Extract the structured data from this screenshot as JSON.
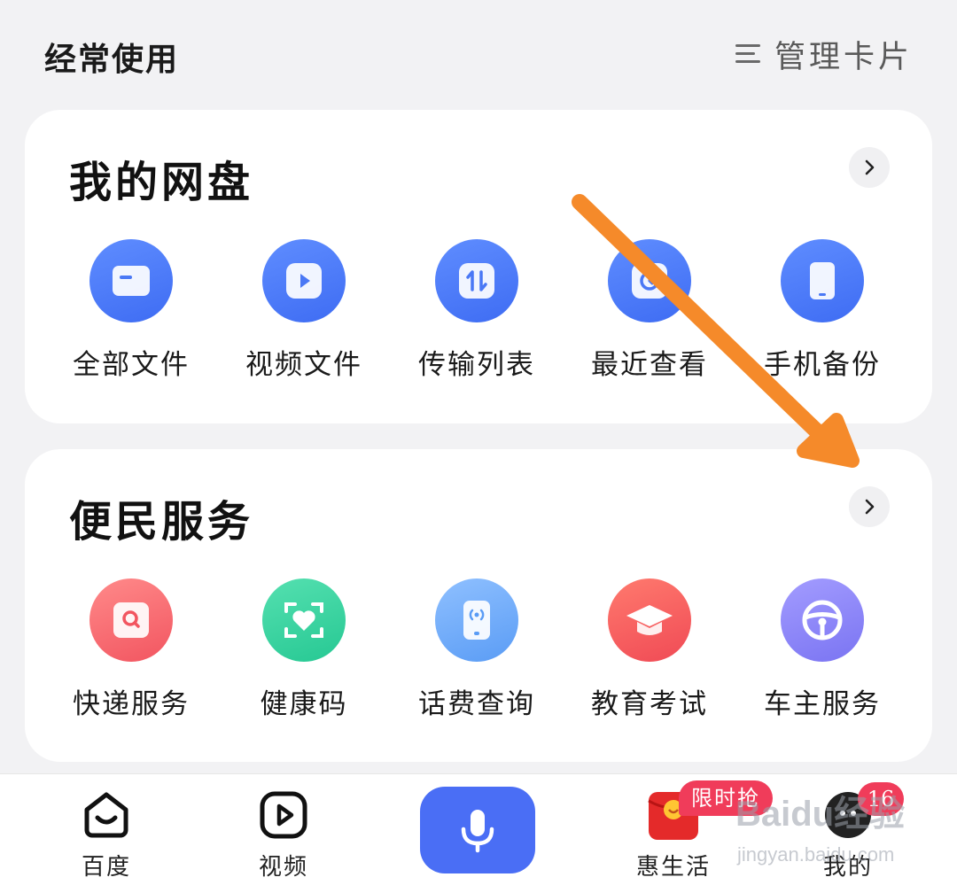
{
  "header": {
    "title": "经常使用",
    "manage_label": "管理卡片",
    "manage_icon": "menu-lines-icon"
  },
  "cards": [
    {
      "title": "我的网盘",
      "more_icon": "chevron-right-icon",
      "items": [
        {
          "label": "全部文件",
          "icon": "folder-icon",
          "color": "#4a78f5"
        },
        {
          "label": "视频文件",
          "icon": "play-icon",
          "color": "#4a78f5"
        },
        {
          "label": "传输列表",
          "icon": "transfer-icon",
          "color": "#4a78f5"
        },
        {
          "label": "最近查看",
          "icon": "recent-icon",
          "color": "#4a78f5"
        },
        {
          "label": "手机备份",
          "icon": "phone-backup-icon",
          "color": "#4a78f5"
        }
      ]
    },
    {
      "title": "便民服务",
      "more_icon": "chevron-right-icon",
      "items": [
        {
          "label": "快递服务",
          "icon": "search-box-icon",
          "color": "#f25560"
        },
        {
          "label": "健康码",
          "icon": "heart-scan-icon",
          "color": "#26c893"
        },
        {
          "label": "话费查询",
          "icon": "phone-signal-icon",
          "color": "#5a9cf5"
        },
        {
          "label": "教育考试",
          "icon": "graduation-cap-icon",
          "color": "#f04a55"
        },
        {
          "label": "车主服务",
          "icon": "steering-wheel-icon",
          "color": "#7a74f2"
        }
      ]
    }
  ],
  "bottom_nav": {
    "items": [
      {
        "label": "百度",
        "icon": "baidu-home-icon"
      },
      {
        "label": "视频",
        "icon": "video-play-icon"
      },
      {
        "label": "",
        "icon": "microphone-icon"
      },
      {
        "label": "惠生活",
        "icon": "red-envelope-icon"
      },
      {
        "label": "我的",
        "icon": "avatar-icon"
      }
    ],
    "promo_badge": "限时抢",
    "count_badge": "16"
  },
  "watermark": {
    "line1": "Baidu经验",
    "line2": "jingyan.baidu.com"
  },
  "colors": {
    "accent": "#4a6ef5",
    "badge": "#f03c5a",
    "annotation_arrow": "#f58a2a"
  }
}
